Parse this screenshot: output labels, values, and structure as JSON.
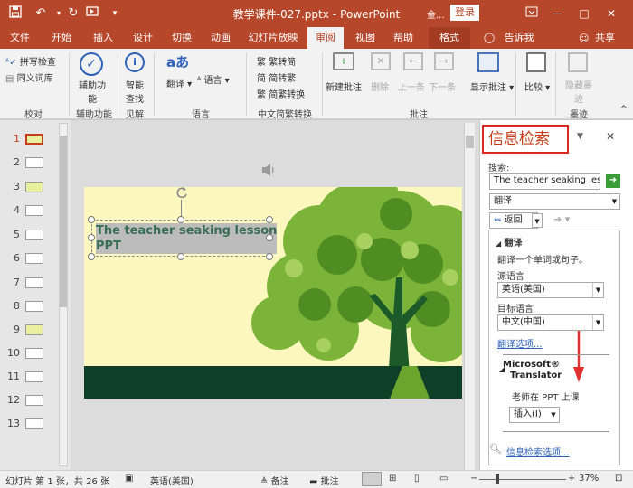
{
  "titlebar": {
    "save_icon": "save-icon",
    "undo_icon": "undo-icon",
    "redo_icon": "redo-icon",
    "slideshow_icon": "from-beginning-icon",
    "customize_icon": "customize-qat-icon",
    "filename": "教学课件-027.pptx",
    "sep": "-",
    "app": "PowerPoint",
    "user": "金...",
    "login": "登录",
    "restore_icon": "ribbon-display-icon",
    "min": "—",
    "max": "□",
    "close": "✕"
  },
  "tabs": [
    "文件",
    "开始",
    "插入",
    "设计",
    "切换",
    "动画",
    "幻灯片放映",
    "审阅",
    "视图",
    "帮助",
    "格式"
  ],
  "tell_me": "告诉我",
  "share": "共享",
  "ribbon": {
    "proofing": {
      "spell": "拼写检查",
      "thesaurus": "同义词库",
      "group": "校对"
    },
    "accessibility": {
      "label1": "辅助功",
      "label2": "能",
      "group": "辅助功能"
    },
    "insights": {
      "label1": "智能",
      "label2": "查找",
      "group": "见解"
    },
    "language": {
      "translate": "翻译",
      "language": "语言",
      "group": "语言"
    },
    "chinese": {
      "t2s": "繁转简",
      "s2t": "简转繁",
      "convert": "简繁转换",
      "group": "中文简繁转换"
    },
    "comments": {
      "new": "新建批注",
      "delete": "删除",
      "prev": "上一条",
      "next": "下一条",
      "group": "批注"
    },
    "show": {
      "label": "显示批注"
    },
    "compare": {
      "label": "比较"
    },
    "ink": {
      "label1": "隐藏墨",
      "label2": "迹",
      "group": "墨迹"
    }
  },
  "thumbnails": [
    "1",
    "2",
    "3",
    "4",
    "5",
    "6",
    "7",
    "8",
    "9",
    "10",
    "11",
    "12",
    "13"
  ],
  "slide": {
    "text_line1": "The teacher seaking lesson",
    "text_line2": "PPT",
    "audio_icon": "speaker-icon",
    "rotate_icon": "rotate-handle-icon"
  },
  "pane": {
    "title": "信息检索",
    "search_label": "搜索:",
    "search_value": "The teacher seaking les",
    "service": "翻译",
    "back": "返回",
    "section": "翻译",
    "desc": "翻译一个单词或句子。",
    "source_label": "源语言",
    "source_value": "英语(美国)",
    "target_label": "目标语言",
    "target_value": "中文(中国)",
    "options_link": "翻译选项...",
    "provider_line1": "Microsoft®",
    "provider_line2": "Translator",
    "result": "老师在 PPT 上课",
    "insert": "插入(I)",
    "research_options": "信息检索选项..."
  },
  "status": {
    "slide_info": "幻灯片 第 1 张，共 26 张",
    "language": "英语(美国)",
    "notes": "备注",
    "comments": "批注",
    "zoom": "37%"
  },
  "colors": {
    "accent": "#b7472a",
    "highlight": "#d9281d",
    "arrow": "#e03030",
    "tree": "#6fa830",
    "ground": "#0f4027"
  }
}
